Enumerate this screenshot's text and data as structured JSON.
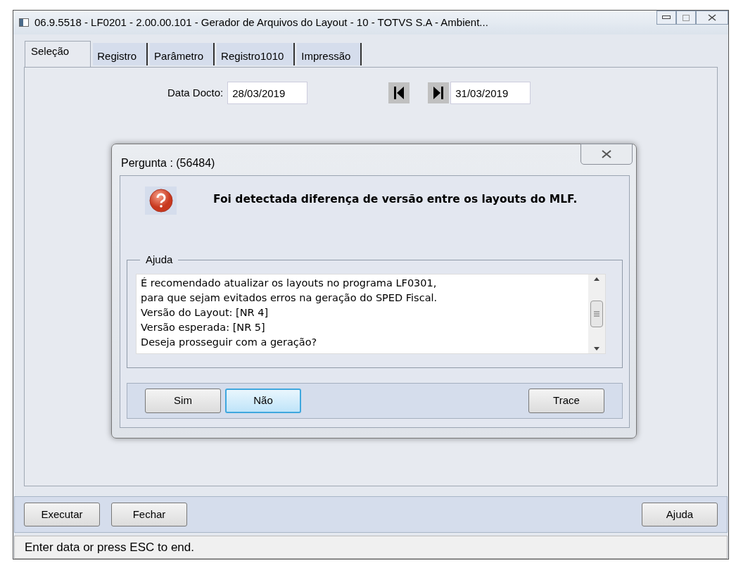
{
  "window": {
    "title": "06.9.5518 - LF0201 - 2.00.00.101 - Gerador de Arquivos do Layout - 10 - TOTVS S.A - Ambient..."
  },
  "tabs": [
    {
      "label": "Seleção",
      "selected": true
    },
    {
      "label": "Registro",
      "selected": false
    },
    {
      "label": "Parâmetro",
      "selected": false
    },
    {
      "label": "Registro1010",
      "selected": false
    },
    {
      "label": "Impressão",
      "selected": false
    }
  ],
  "date_range": {
    "label": "Data Docto:",
    "from": "28/03/2019",
    "to": "31/03/2019"
  },
  "dialog": {
    "title": "Pergunta : (56484)",
    "message": "Foi detectada diferença de versão entre os layouts do MLF.",
    "help_label": "Ajuda",
    "help_lines": [
      "É recomendado atualizar os layouts no programa LF0301,",
      "para que sejam evitados erros na geração do SPED Fiscal.",
      "Versão do Layout: [NR 4]",
      "Versão esperada: [NR 5]",
      "Deseja prosseguir com a geração?"
    ],
    "buttons_left": [
      {
        "label": "Sim",
        "focused": false
      },
      {
        "label": "Não",
        "focused": true
      }
    ],
    "buttons_right": [
      {
        "label": "Trace",
        "focused": false
      }
    ]
  },
  "footer_buttons_left": [
    "Executar",
    "Fechar"
  ],
  "footer_buttons_right": [
    "Ajuda"
  ],
  "status_bar": "Enter data or press ESC to end."
}
